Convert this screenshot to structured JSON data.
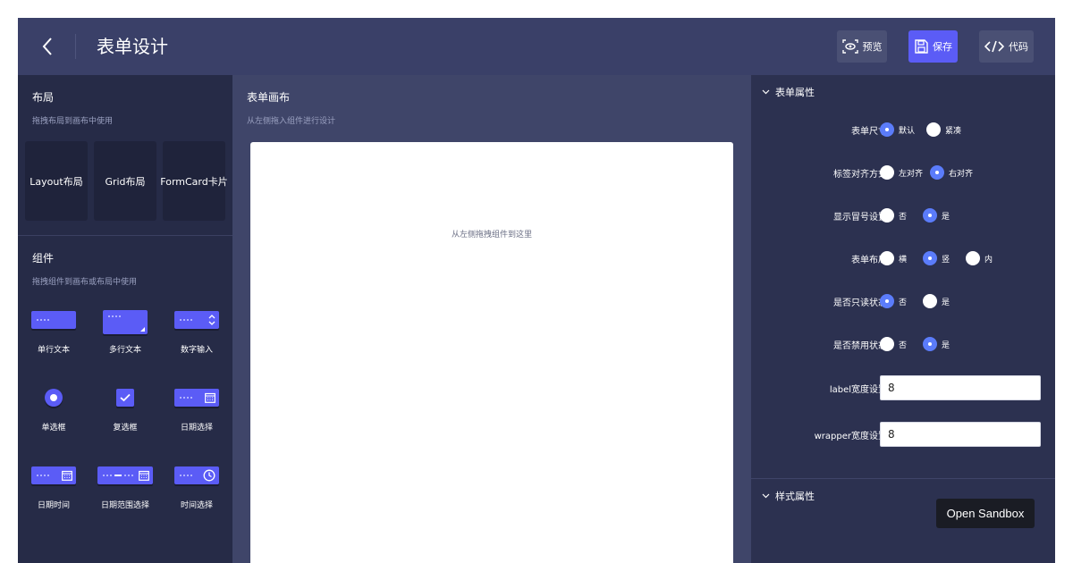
{
  "header": {
    "title": "表单设计",
    "buttons": [
      {
        "label": "预览",
        "icon": "eye-icon"
      },
      {
        "label": "保存",
        "icon": "save-icon"
      },
      {
        "label": "代码",
        "icon": "code-icon"
      }
    ],
    "colors": {
      "bar": "#3a4068",
      "primary": "#5b5cf6"
    }
  },
  "layouts": {
    "title": "布局",
    "subtitle": "拖拽布局到画布中使用",
    "items": [
      "Layout布局",
      "Grid布局",
      "FormCard卡片"
    ]
  },
  "components": {
    "title": "组件",
    "subtitle": "拖拽组件到画布或布局中使用",
    "items": [
      "单行文本",
      "多行文本",
      "数字输入",
      "单选框",
      "复选框",
      "日期选择",
      "日期时间",
      "日期范围选择",
      "时间选择"
    ]
  },
  "canvas": {
    "title": "表单画布",
    "subtitle": "从左侧拖入组件进行设计",
    "hint": "从左侧拖拽组件到这里"
  },
  "properties": {
    "form_section": "表单属性",
    "fields": [
      {
        "label": "表单尺寸",
        "options": [
          "默认",
          "紧凑"
        ],
        "selected": 0
      },
      {
        "label": "标签对齐方式",
        "options": [
          "左对齐",
          "右对齐"
        ],
        "selected": 1
      },
      {
        "label": "显示冒号设置",
        "options": [
          "否",
          "是"
        ],
        "selected": 1
      },
      {
        "label": "表单布局",
        "options": [
          "横",
          "竖",
          "内"
        ],
        "selected": 1
      },
      {
        "label": "是否只读状态",
        "options": [
          "否",
          "是"
        ],
        "selected": 0
      },
      {
        "label": "是否禁用状态",
        "options": [
          "否",
          "是"
        ],
        "selected": 1
      }
    ],
    "label_col_label": "label宽度设置",
    "label_col_value": "8",
    "wrapper_col_label": "wrapper宽度设置",
    "wrapper_col_value": "8",
    "style_section": "样式属性"
  },
  "sandbox_label": "Open Sandbox"
}
